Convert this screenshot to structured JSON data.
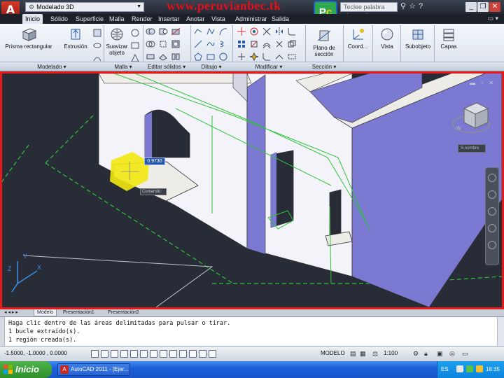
{
  "app": {
    "logo_letter": "A",
    "workspace": "Modelado 3D",
    "watermark": "www.peruvianbec.tk",
    "badge_left": "P",
    "badge_right": "c",
    "search_placeholder": "Teclee palabra clave o frase"
  },
  "tabs": [
    {
      "label": "Inicio",
      "active": true
    },
    {
      "label": "Sólido"
    },
    {
      "label": "Superficie"
    },
    {
      "label": "Malla"
    },
    {
      "label": "Render"
    },
    {
      "label": "Insertar"
    },
    {
      "label": "Anotar"
    },
    {
      "label": "Vista"
    },
    {
      "label": "Administrar"
    },
    {
      "label": "Salida"
    }
  ],
  "ribbon": {
    "modelado": {
      "title": "Modelado",
      "box_label": "Prisma rectangular",
      "extrude_label": "Extrusión"
    },
    "malla": {
      "title": "Malla",
      "smooth_label": "Suavizar objeto"
    },
    "editar_solidos": {
      "title": "Editar sólidos"
    },
    "dibujo": {
      "title": "Dibujo"
    },
    "modificar": {
      "title": "Modificar"
    },
    "seccion": {
      "title": "Sección",
      "plane_label": "Plano de sección"
    },
    "coord_label": "Coord...",
    "vista_label": "Vista",
    "subobjeto_label": "Subobjeto",
    "capas_label": "Capas"
  },
  "viewport": {
    "dimension_input": "0.9730",
    "command_tooltip": "Comando:",
    "ucs_name": "S-nombre",
    "compass_letter": "W",
    "colors": {
      "border": "#e51b1b",
      "background": "#272c36",
      "wall_face": "#f4f3fa",
      "wall_side": "#7b79d1",
      "highlight": "#f2e80f",
      "green_lines": "#2fc43b"
    }
  },
  "layout_tabs": [
    "Modelo",
    "Presentación1",
    "Presentación2"
  ],
  "command_history": [
    "Haga clic dentro de las áreas delimitadas para pulsar o tirar.",
    "1 bucle extraído(s).",
    "1 región creada(s)."
  ],
  "status": {
    "coords": "-1.5000, -1.0000 , 0.0000",
    "model": "MODELO",
    "scale": "1:100"
  },
  "taskbar": {
    "start_label": "Inicio",
    "task_label": "AutoCAD 2011 - [Ejer...",
    "language": "ES",
    "clock": "18:35"
  }
}
